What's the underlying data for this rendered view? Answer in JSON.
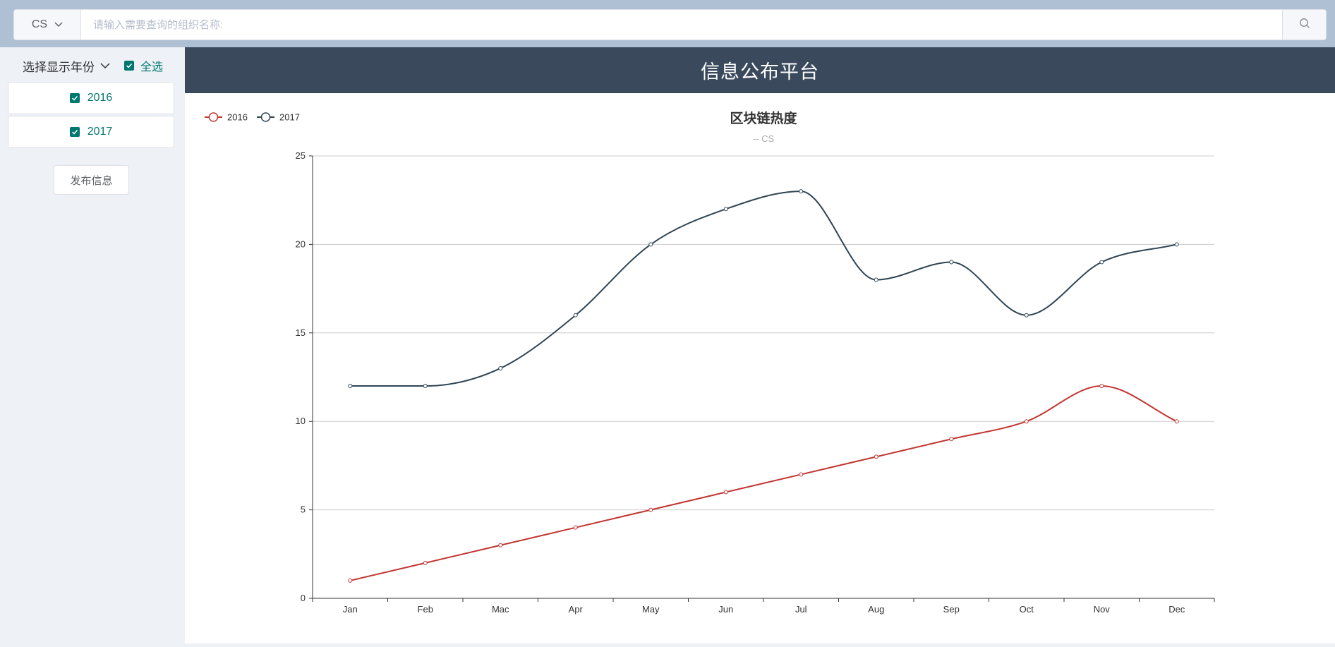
{
  "search": {
    "org_value": "CS",
    "placeholder": "请输入需要查询的组织名称:"
  },
  "sidebar": {
    "year_select_label": "选择显示年份",
    "select_all_label": "全选",
    "years": [
      "2016",
      "2017"
    ],
    "publish_button_label": "发布信息"
  },
  "header": {
    "title": "信息公布平台"
  },
  "icons": {
    "search": "search-icon",
    "dropdown": "chevron-down-icon",
    "checkbox": "checkbox-checked-icon"
  },
  "colors": {
    "accent": "#00786f",
    "header_bg": "#3a4a5c",
    "series_2016": "#c23531",
    "series_2017": "#2f4554"
  },
  "chart_data": {
    "type": "line",
    "title": "区块链热度",
    "subtitle": "-- CS",
    "categories": [
      "Jan",
      "Feb",
      "Mac",
      "Apr",
      "May",
      "Jun",
      "Jul",
      "Aug",
      "Sep",
      "Oct",
      "Nov",
      "Dec"
    ],
    "series": [
      {
        "name": "2016",
        "color": "#c23531",
        "values": [
          1,
          2,
          3,
          4,
          5,
          6,
          7,
          8,
          9,
          10,
          12,
          10
        ]
      },
      {
        "name": "2017",
        "color": "#2f4554",
        "values": [
          12,
          12,
          13,
          16,
          20,
          22,
          23,
          18,
          19,
          16,
          19,
          20
        ]
      }
    ],
    "ylim": [
      0,
      25
    ],
    "yticks": [
      0,
      5,
      10,
      15,
      20,
      25
    ],
    "smooth": true,
    "grid": true,
    "legend_position": "top-left"
  }
}
